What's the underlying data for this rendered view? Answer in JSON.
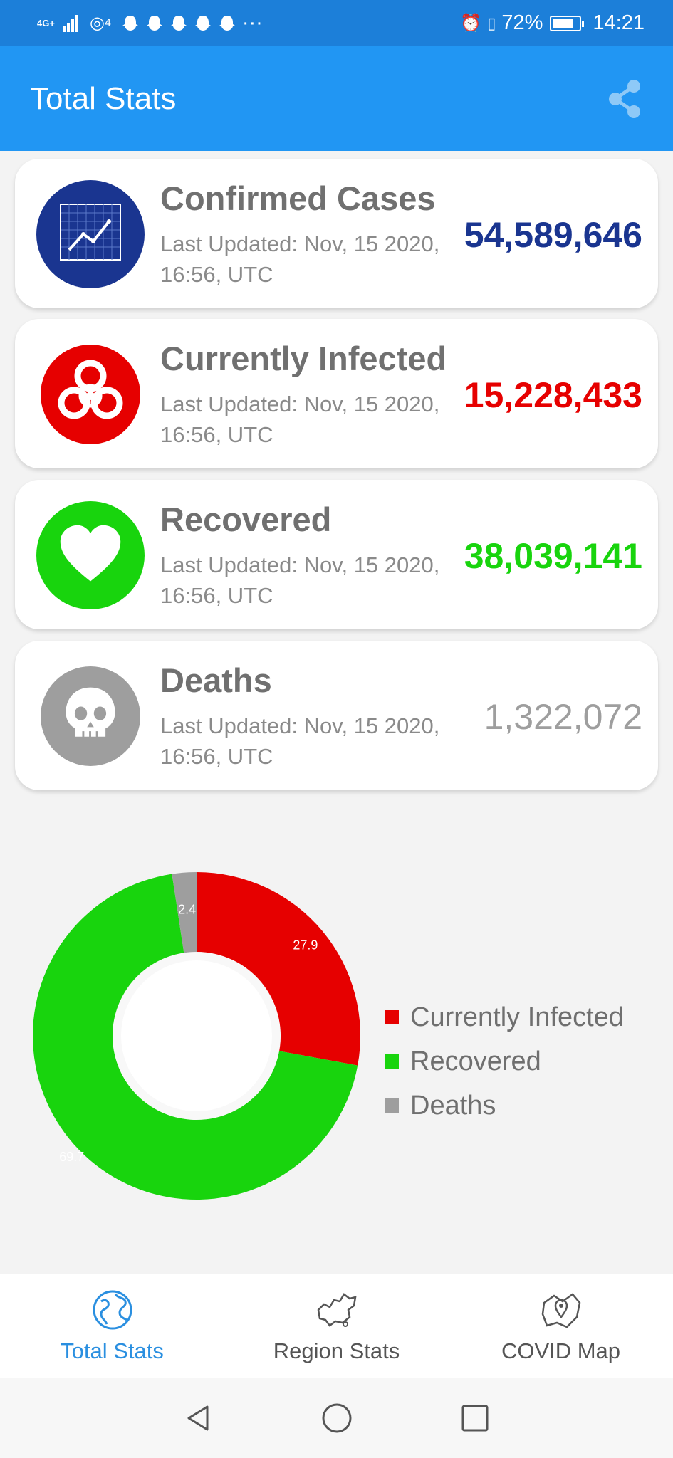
{
  "status_bar": {
    "network": "4G+",
    "hotspot_count": "4",
    "battery_percent": "72%",
    "time": "14:21",
    "notification_icons": [
      "snapchat-icon",
      "snapchat-icon",
      "snapchat-icon",
      "snapchat-icon",
      "snapchat-icon"
    ],
    "more": "···"
  },
  "appbar": {
    "title": "Total Stats",
    "share_icon": "share-icon"
  },
  "cards": [
    {
      "title": "Confirmed Cases",
      "updated": "Last Updated: Nov, 15 2020, 16:56, UTC",
      "value": "54,589,646",
      "color": "#1a3590",
      "icon": "chart-icon"
    },
    {
      "title": "Currently Infected",
      "updated": "Last Updated: Nov, 15 2020, 16:56, UTC",
      "value": "15,228,433",
      "color": "#e60000",
      "icon": "biohazard-icon"
    },
    {
      "title": "Recovered",
      "updated": "Last Updated: Nov, 15 2020, 16:56, UTC",
      "value": "38,039,141",
      "color": "#18d40d",
      "icon": "heart-icon"
    },
    {
      "title": "Deaths",
      "updated": "Last Updated: Nov, 15 2020, 16:56, UTC",
      "value": "1,322,072",
      "color": "#9e9e9e",
      "icon": "skull-icon"
    }
  ],
  "chart_data": {
    "type": "pie",
    "categories": [
      "Currently Infected",
      "Recovered",
      "Deaths"
    ],
    "values": [
      27.9,
      69.7,
      2.4
    ],
    "colors": [
      "#e60000",
      "#18d40d",
      "#9e9e9e"
    ],
    "labels": [
      "27.9",
      "69.7",
      "2.4"
    ],
    "legend_position": "right",
    "donut": true
  },
  "bottom_nav": [
    {
      "label": "Total Stats",
      "icon": "globe-icon",
      "active": true
    },
    {
      "label": "Region Stats",
      "icon": "map-region-icon",
      "active": false
    },
    {
      "label": "COVID Map",
      "icon": "map-pin-icon",
      "active": false
    }
  ]
}
